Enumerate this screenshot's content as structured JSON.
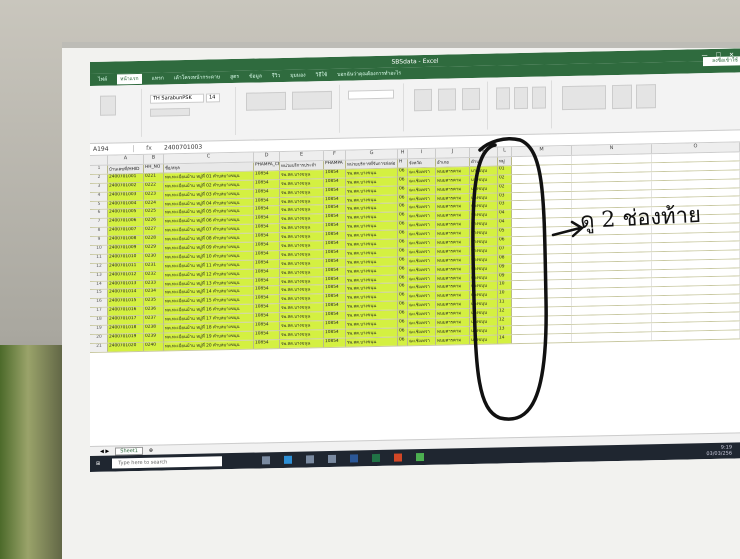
{
  "window": {
    "title": "SBSdata - Excel",
    "signin_label": "ลงชื่อเข้าใช้"
  },
  "ribbon": {
    "tabs": [
      "ไฟล์",
      "หน้าแรก",
      "แทรก",
      "เค้าโครงหน้ากระดาษ",
      "สูตร",
      "ข้อมูล",
      "รีวิว",
      "มุมมอง",
      "วิธีใช้",
      "บอกฉันว่าคุณต้องการทำอะไร"
    ],
    "font_name": "TH SarabunPSK",
    "font_size": "14"
  },
  "formula_bar": {
    "name_box": "A194",
    "value": "2400701003"
  },
  "columns": [
    "A",
    "B",
    "C",
    "D",
    "E",
    "F",
    "G",
    "H",
    "I",
    "J",
    "K",
    "L",
    "M",
    "N",
    "O"
  ],
  "header_row": [
    "บ้านเลขที่/HHID",
    "HH_NO",
    "ชื่อ/สกุล",
    "PHAMPA_CP",
    "หน่วยบริการประจำ",
    "PHAMPA",
    "หน่วยบริการที่รับการส่งต่อ",
    "H",
    "จังหวัด",
    "อำเภอ",
    "ตำบล",
    "หมู่",
    "",
    "",
    ""
  ],
  "rows": [
    {
      "num": "2",
      "a": "2400701001",
      "b": "0221",
      "c": "ทต.ทะเบียนบ้าน หมู่ที่ 01 ตำบลบางขนุน",
      "d": "10854",
      "e": "รพ.สต.บางขนุน",
      "f": "10854",
      "g": "รพ.สต.บางขนุน",
      "h": "06",
      "i": "ฉะเชิงเทรา",
      "j": "พนมสารคาม",
      "k": "บางขนุน",
      "l": "01"
    },
    {
      "num": "3",
      "a": "2400701002",
      "b": "0222",
      "c": "ทต.ทะเบียนบ้าน หมู่ที่ 02 ตำบลบางขนุน",
      "d": "10854",
      "e": "รพ.สต.บางขนุน",
      "f": "10854",
      "g": "รพ.สต.บางขนุน",
      "h": "06",
      "i": "ฉะเชิงเทรา",
      "j": "พนมสารคาม",
      "k": "บางขนุน",
      "l": "02"
    },
    {
      "num": "4",
      "a": "2400701003",
      "b": "0223",
      "c": "ทต.ทะเบียนบ้าน หมู่ที่ 03 ตำบลบางขนุน",
      "d": "10854",
      "e": "รพ.สต.บางขนุน",
      "f": "10854",
      "g": "รพ.สต.บางขนุน",
      "h": "06",
      "i": "ฉะเชิงเทรา",
      "j": "พนมสารคาม",
      "k": "บางขนุน",
      "l": "02"
    },
    {
      "num": "5",
      "a": "2400701004",
      "b": "0224",
      "c": "ทต.ทะเบียนบ้าน หมู่ที่ 04 ตำบลบางขนุน",
      "d": "10854",
      "e": "รพ.สต.บางขนุน",
      "f": "10854",
      "g": "รพ.สต.บางขนุน",
      "h": "06",
      "i": "ฉะเชิงเทรา",
      "j": "พนมสารคาม",
      "k": "บางขนุน",
      "l": "03"
    },
    {
      "num": "6",
      "a": "2400701005",
      "b": "0225",
      "c": "ทต.ทะเบียนบ้าน หมู่ที่ 05 ตำบลบางขนุน",
      "d": "10854",
      "e": "รพ.สต.บางขนุน",
      "f": "10854",
      "g": "รพ.สต.บางขนุน",
      "h": "06",
      "i": "ฉะเชิงเทรา",
      "j": "พนมสารคาม",
      "k": "บางขนุน",
      "l": "03"
    },
    {
      "num": "7",
      "a": "2400701006",
      "b": "0226",
      "c": "ทต.ทะเบียนบ้าน หมู่ที่ 06 ตำบลบางขนุน",
      "d": "10854",
      "e": "รพ.สต.บางขนุน",
      "f": "10854",
      "g": "รพ.สต.บางขนุน",
      "h": "06",
      "i": "ฉะเชิงเทรา",
      "j": "พนมสารคาม",
      "k": "บางขนุน",
      "l": "04"
    },
    {
      "num": "8",
      "a": "2400701007",
      "b": "0227",
      "c": "ทต.ทะเบียนบ้าน หมู่ที่ 07 ตำบลบางขนุน",
      "d": "10854",
      "e": "รพ.สต.บางขนุน",
      "f": "10854",
      "g": "รพ.สต.บางขนุน",
      "h": "06",
      "i": "ฉะเชิงเทรา",
      "j": "พนมสารคาม",
      "k": "บางขนุน",
      "l": "04"
    },
    {
      "num": "9",
      "a": "2400701008",
      "b": "0228",
      "c": "ทต.ทะเบียนบ้าน หมู่ที่ 08 ตำบลบางขนุน",
      "d": "10854",
      "e": "รพ.สต.บางขนุน",
      "f": "10854",
      "g": "รพ.สต.บางขนุน",
      "h": "06",
      "i": "ฉะเชิงเทรา",
      "j": "พนมสารคาม",
      "k": "บางขนุน",
      "l": "05"
    },
    {
      "num": "10",
      "a": "2400701009",
      "b": "0229",
      "c": "ทต.ทะเบียนบ้าน หมู่ที่ 09 ตำบลบางขนุน",
      "d": "10854",
      "e": "รพ.สต.บางขนุน",
      "f": "10854",
      "g": "รพ.สต.บางขนุน",
      "h": "06",
      "i": "ฉะเชิงเทรา",
      "j": "พนมสารคาม",
      "k": "บางขนุน",
      "l": "06"
    },
    {
      "num": "11",
      "a": "2400701010",
      "b": "0230",
      "c": "ทต.ทะเบียนบ้าน หมู่ที่ 10 ตำบลบางขนุน",
      "d": "10854",
      "e": "รพ.สต.บางขนุน",
      "f": "10854",
      "g": "รพ.สต.บางขนุน",
      "h": "06",
      "i": "ฉะเชิงเทรา",
      "j": "พนมสารคาม",
      "k": "บางขนุน",
      "l": "07"
    },
    {
      "num": "12",
      "a": "2400701011",
      "b": "0231",
      "c": "ทต.ทะเบียนบ้าน หมู่ที่ 11 ตำบลบางขนุน",
      "d": "10854",
      "e": "รพ.สต.บางขนุน",
      "f": "10854",
      "g": "รพ.สต.บางขนุน",
      "h": "06",
      "i": "ฉะเชิงเทรา",
      "j": "พนมสารคาม",
      "k": "บางขนุน",
      "l": "08"
    },
    {
      "num": "13",
      "a": "2400701012",
      "b": "0232",
      "c": "ทต.ทะเบียนบ้าน หมู่ที่ 12 ตำบลบางขนุน",
      "d": "10854",
      "e": "รพ.สต.บางขนุน",
      "f": "10854",
      "g": "รพ.สต.บางขนุน",
      "h": "06",
      "i": "ฉะเชิงเทรา",
      "j": "พนมสารคาม",
      "k": "บางขนุน",
      "l": "09"
    },
    {
      "num": "14",
      "a": "2400701013",
      "b": "0233",
      "c": "ทต.ทะเบียนบ้าน หมู่ที่ 13 ตำบลบางขนุน",
      "d": "10854",
      "e": "รพ.สต.บางขนุน",
      "f": "10854",
      "g": "รพ.สต.บางขนุน",
      "h": "06",
      "i": "ฉะเชิงเทรา",
      "j": "พนมสารคาม",
      "k": "บางขนุน",
      "l": "09"
    },
    {
      "num": "15",
      "a": "2400701014",
      "b": "0234",
      "c": "ทต.ทะเบียนบ้าน หมู่ที่ 14 ตำบลบางขนุน",
      "d": "10854",
      "e": "รพ.สต.บางขนุน",
      "f": "10854",
      "g": "รพ.สต.บางขนุน",
      "h": "06",
      "i": "ฉะเชิงเทรา",
      "j": "พนมสารคาม",
      "k": "บางขนุน",
      "l": "10"
    },
    {
      "num": "16",
      "a": "2400701015",
      "b": "0235",
      "c": "ทต.ทะเบียนบ้าน หมู่ที่ 15 ตำบลบางขนุน",
      "d": "10854",
      "e": "รพ.สต.บางขนุน",
      "f": "10854",
      "g": "รพ.สต.บางขนุน",
      "h": "06",
      "i": "ฉะเชิงเทรา",
      "j": "พนมสารคาม",
      "k": "บางขนุน",
      "l": "10"
    },
    {
      "num": "17",
      "a": "2400701016",
      "b": "0236",
      "c": "ทต.ทะเบียนบ้าน หมู่ที่ 16 ตำบลบางขนุน",
      "d": "10854",
      "e": "รพ.สต.บางขนุน",
      "f": "10854",
      "g": "รพ.สต.บางขนุน",
      "h": "06",
      "i": "ฉะเชิงเทรา",
      "j": "พนมสารคาม",
      "k": "บางขนุน",
      "l": "11"
    },
    {
      "num": "18",
      "a": "2400701017",
      "b": "0237",
      "c": "ทต.ทะเบียนบ้าน หมู่ที่ 17 ตำบลบางขนุน",
      "d": "10854",
      "e": "รพ.สต.บางขนุน",
      "f": "10854",
      "g": "รพ.สต.บางขนุน",
      "h": "06",
      "i": "ฉะเชิงเทรา",
      "j": "พนมสารคาม",
      "k": "บางขนุน",
      "l": "12"
    },
    {
      "num": "19",
      "a": "2400701018",
      "b": "0238",
      "c": "ทต.ทะเบียนบ้าน หมู่ที่ 18 ตำบลบางขนุน",
      "d": "10854",
      "e": "รพ.สต.บางขนุน",
      "f": "10854",
      "g": "รพ.สต.บางขนุน",
      "h": "06",
      "i": "ฉะเชิงเทรา",
      "j": "พนมสารคาม",
      "k": "บางขนุน",
      "l": "12"
    },
    {
      "num": "20",
      "a": "2400701019",
      "b": "0239",
      "c": "ทต.ทะเบียนบ้าน หมู่ที่ 19 ตำบลบางขนุน",
      "d": "10854",
      "e": "รพ.สต.บางขนุน",
      "f": "10854",
      "g": "รพ.สต.บางขนุน",
      "h": "06",
      "i": "ฉะเชิงเทรา",
      "j": "พนมสารคาม",
      "k": "บางขนุน",
      "l": "13"
    },
    {
      "num": "21",
      "a": "2400701020",
      "b": "0240",
      "c": "ทต.ทะเบียนบ้าน หมู่ที่ 20 ตำบลบางขนุน",
      "d": "10854",
      "e": "รพ.สต.บางขนุน",
      "f": "10854",
      "g": "รพ.สต.บางขนุน",
      "h": "06",
      "i": "ฉะเชิงเทรา",
      "j": "พนมสารคาม",
      "k": "บางขนุน",
      "l": "14"
    }
  ],
  "status": {
    "sheet_tab": "Sheet1"
  },
  "taskbar": {
    "search_placeholder": "Type here to search",
    "time": "9:19",
    "date": "03/03/256"
  },
  "annotation": {
    "text": "ดู 2 ช่องท้าย"
  }
}
